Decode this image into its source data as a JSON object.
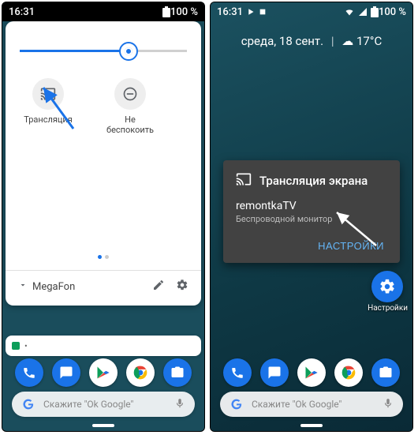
{
  "left": {
    "status": {
      "time": "16:31",
      "battery": "100 %"
    },
    "brightness": {
      "percent": 65
    },
    "tiles": [
      {
        "id": "cast",
        "label": "Трансляция"
      },
      {
        "id": "dnd",
        "label": "Не беспокоить"
      }
    ],
    "carrier": "MegaFon",
    "search_placeholder": "Скажите \"Ok Google\""
  },
  "right": {
    "status": {
      "time": "16:31",
      "battery": "100 %"
    },
    "date": "среда, 18 сент.",
    "weather": "17°C",
    "dialog": {
      "title": "Трансляция экрана",
      "device": "remontkaTV",
      "subtitle": "Беспроводной монитор",
      "settings_btn": "НАСТРОЙКИ"
    },
    "settings_label": "Настройки",
    "search_placeholder": "Скажите \"Ok Google\""
  }
}
